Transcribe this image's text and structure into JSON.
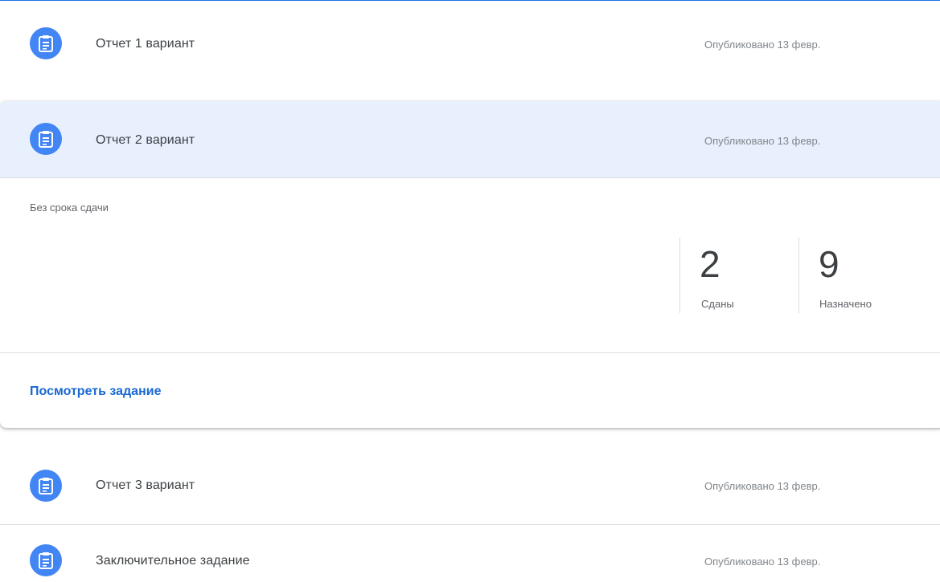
{
  "accent_color": "#4285f4",
  "link_color": "#1967d2",
  "highlight_color": "#e8f0fe",
  "assignments": [
    {
      "title": "Отчет 1 вариант",
      "published": "Опубликовано 13 февр.",
      "icon": "assignment-icon"
    },
    {
      "title": "Отчет 2 вариант",
      "published": "Опубликовано 13 февр.",
      "icon": "assignment-icon"
    },
    {
      "title": "Отчет 3 вариант",
      "published": "Опубликовано 13 февр.",
      "icon": "assignment-icon"
    },
    {
      "title": "Заключительное задание",
      "published": "Опубликовано 13 февр.",
      "icon": "assignment-icon"
    }
  ],
  "expanded": {
    "due": "Без срока сдачи",
    "stats": [
      {
        "value": "2",
        "label": "Сданы"
      },
      {
        "value": "9",
        "label": "Назначено"
      }
    ],
    "view_link": "Посмотреть задание"
  }
}
